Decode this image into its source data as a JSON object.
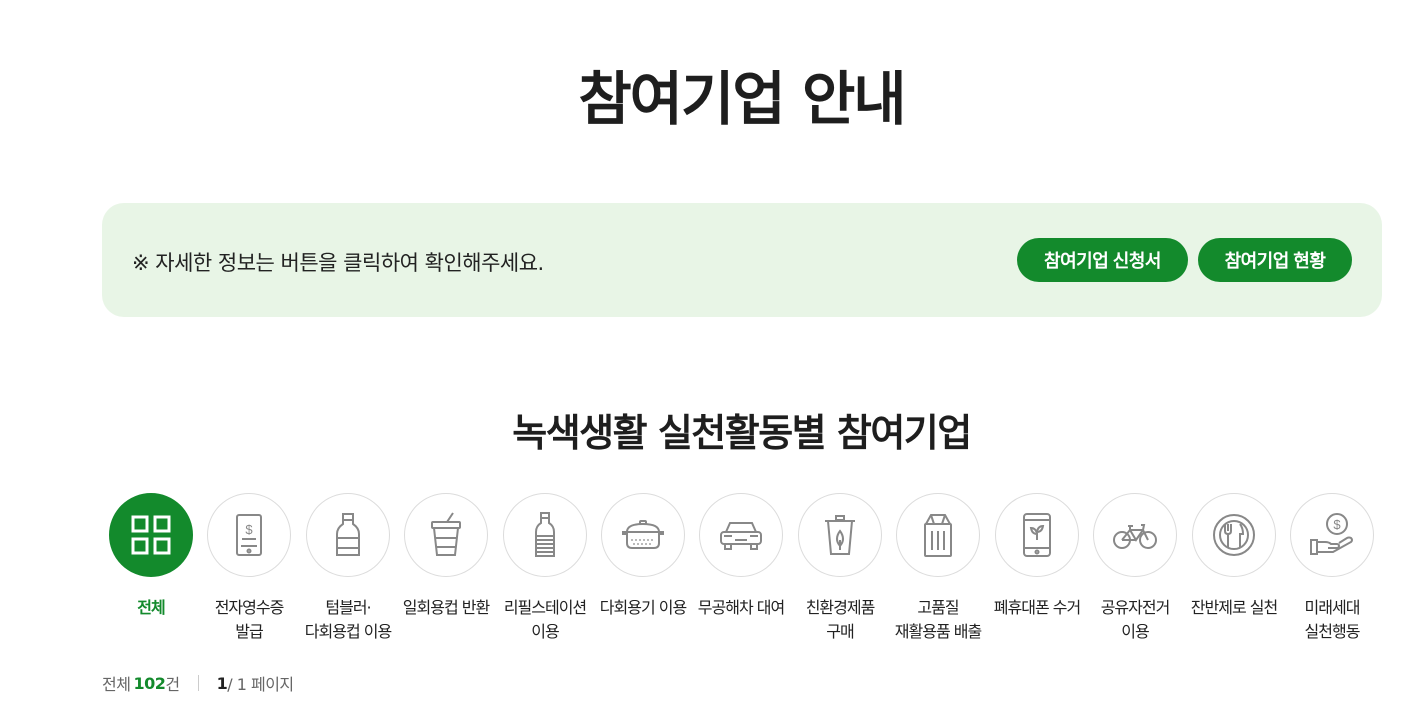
{
  "page": {
    "title": "참여기업 안내"
  },
  "info": {
    "text": "※ 자세한 정보는 버튼을 클릭하여 확인해주세요.",
    "apply_button": "참여기업 신청서",
    "status_button": "참여기업 현황"
  },
  "section": {
    "title": "녹색생활 실천활동별 참여기업"
  },
  "categories": [
    {
      "icon": "grid-icon",
      "line1": "전체",
      "line2": "",
      "active": true
    },
    {
      "icon": "receipt-phone-icon",
      "line1": "전자영수증",
      "line2": "발급",
      "active": false
    },
    {
      "icon": "bottle-icon",
      "line1": "텀블러·",
      "line2": "다회용컵 이용",
      "active": false
    },
    {
      "icon": "cup-icon",
      "line1": "일회용컵 반환",
      "line2": "",
      "active": false
    },
    {
      "icon": "refill-bottle-icon",
      "line1": "리필스테이션",
      "line2": "이용",
      "active": false
    },
    {
      "icon": "container-icon",
      "line1": "다회용기 이용",
      "line2": "",
      "active": false
    },
    {
      "icon": "car-icon",
      "line1": "무공해차 대여",
      "line2": "",
      "active": false
    },
    {
      "icon": "eco-bin-icon",
      "line1": "친환경제품",
      "line2": "구매",
      "active": false
    },
    {
      "icon": "recycle-bin-icon",
      "line1": "고품질",
      "line2": "재활용품 배출",
      "active": false
    },
    {
      "icon": "phone-leaf-icon",
      "line1": "폐휴대폰 수거",
      "line2": "",
      "active": false
    },
    {
      "icon": "bicycle-icon",
      "line1": "공유자전거",
      "line2": "이용",
      "active": false
    },
    {
      "icon": "plate-cutlery-icon",
      "line1": "잔반제로 실천",
      "line2": "",
      "active": false
    },
    {
      "icon": "hand-coin-icon",
      "line1": "미래세대",
      "line2": "실천행동",
      "active": false
    }
  ],
  "summary": {
    "total_label": "전체",
    "total_count": "102",
    "count_unit": "건",
    "current_page": "1",
    "page_rest": "/ 1 페이지"
  },
  "colors": {
    "accent": "#138a2c",
    "info_bg": "#e8f5e6",
    "icon_gray": "#888888"
  }
}
